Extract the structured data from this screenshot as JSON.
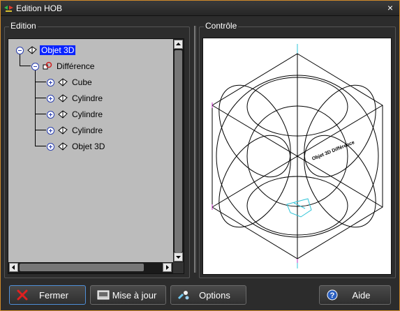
{
  "window": {
    "title": "Edition HOB",
    "close": "×"
  },
  "edition": {
    "label": "Edition",
    "tree": [
      {
        "label": "Objet 3D",
        "icon": "object-3d-icon"
      },
      {
        "label": "Différence",
        "icon": "difference-icon"
      },
      {
        "label": "Cube",
        "icon": "cube-icon"
      },
      {
        "label": "Cylindre",
        "icon": "cylinder-icon"
      },
      {
        "label": "Cylindre",
        "icon": "cylinder-icon"
      },
      {
        "label": "Cylindre",
        "icon": "cylinder-icon"
      },
      {
        "label": "Objet 3D",
        "icon": "object-3d-icon"
      }
    ]
  },
  "controle": {
    "label": "Contrôle",
    "overlay_text": "Objet 3D Différence"
  },
  "buttons": {
    "fermer": "Fermer",
    "mise_a_jour": "Mise à jour",
    "options": "Options",
    "aide": "Aide"
  },
  "colors": {
    "accent": "#d08a2a",
    "selection": "#0a24ff",
    "axis": "#2ec4d8",
    "close_red": "#e02020"
  }
}
